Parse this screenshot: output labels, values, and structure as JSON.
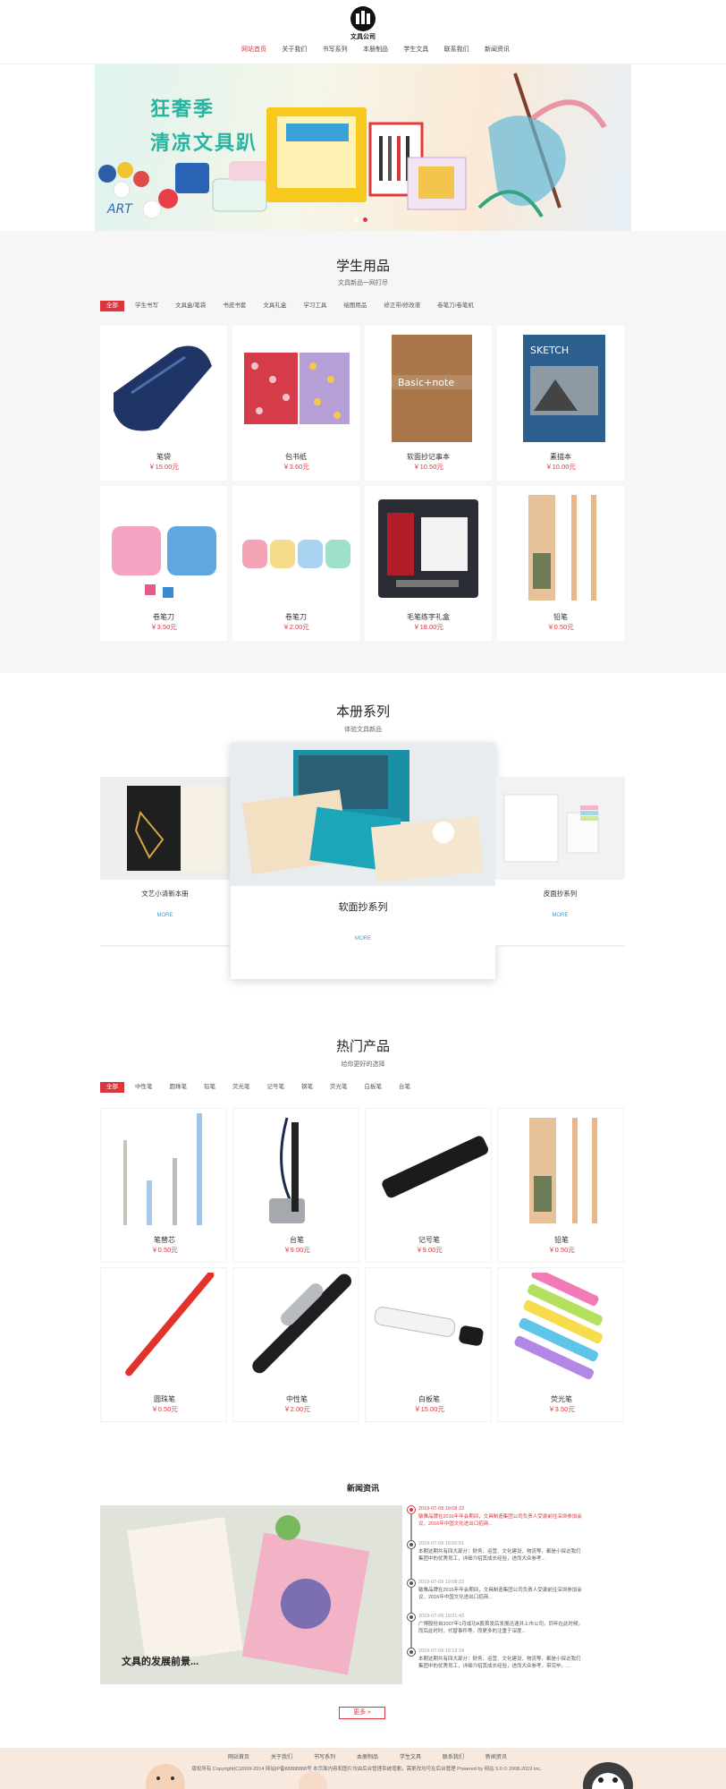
{
  "header": {
    "logo_text": "文具公司",
    "nav": [
      "网站首页",
      "关于我们",
      "书写系列",
      "本册制品",
      "学生文具",
      "联系我们",
      "新闻资讯"
    ]
  },
  "banner": {
    "line1": "狂奢季",
    "line2": "清凉文具趴",
    "art_text": "ART"
  },
  "student": {
    "title": "学生用品",
    "subtitle": "文具新品一网打尽",
    "tabs": [
      "全部",
      "学生书写",
      "文具盒/笔袋",
      "书皮书套",
      "文具礼盒",
      "学习工具",
      "绘图用品",
      "修正带/修改液",
      "卷笔刀/卷笔机"
    ],
    "items": [
      {
        "name": "笔袋",
        "price": "￥15.00元"
      },
      {
        "name": "包书纸",
        "price": "￥3.60元"
      },
      {
        "name": "软面抄记事本",
        "price": "￥10.50元"
      },
      {
        "name": "素描本",
        "price": "￥10.00元"
      },
      {
        "name": "卷笔刀",
        "price": "￥3.50元"
      },
      {
        "name": "卷笔刀",
        "price": "￥2.00元"
      },
      {
        "name": "毛笔练字礼盒",
        "price": "￥18.00元"
      },
      {
        "name": "铅笔",
        "price": "￥0.50元"
      }
    ]
  },
  "notebooks": {
    "title": "本册系列",
    "subtitle": "体验文具新品",
    "left": {
      "name": "文艺小清新本册",
      "more": "MORE"
    },
    "center": {
      "name": "软面抄系列",
      "more": "MORE"
    },
    "right": {
      "name": "皮面抄系列",
      "more": "MORE"
    }
  },
  "hot": {
    "title": "热门产品",
    "subtitle": "给你更好的选择",
    "tabs": [
      "全部",
      "中性笔",
      "圆珠笔",
      "铅笔",
      "荧光笔",
      "记号笔",
      "钢笔",
      "荧光笔",
      "白板笔",
      "台笔"
    ],
    "items": [
      {
        "name": "笔替芯",
        "price": "￥0.50元"
      },
      {
        "name": "台笔",
        "price": "￥9.00元"
      },
      {
        "name": "记号笔",
        "price": "￥9.00元"
      },
      {
        "name": "铅笔",
        "price": "￥0.50元"
      },
      {
        "name": "圆珠笔",
        "price": "￥0.50元"
      },
      {
        "name": "中性笔",
        "price": "￥2.00元"
      },
      {
        "name": "白板笔",
        "price": "￥15.00元"
      },
      {
        "name": "荧光笔",
        "price": "￥3.50元"
      }
    ]
  },
  "news": {
    "title": "新闻资讯",
    "image_caption": "文具的发展前景...",
    "items": [
      {
        "date": "2019-07-09 19:08:23",
        "text": "敏雅品牌在2016年年会期间，文具制造集团公司负责人受激前往深圳参加会议，2016年中国文化进出口招商..."
      },
      {
        "date": "2019-07-09 18:50:51",
        "text": "本期这期共有四大部分：财务、运营、文化建设、物流等，都是小探访我们集团中的优秀员工，详细介绍其成长经验，进而大众参考..."
      },
      {
        "date": "2019-07-09 19:08:23",
        "text": "敏雅品牌在2016年年会期间，文具制造集团公司负责人受激前往深圳参加会议，2016年中国文化进出口招商..."
      },
      {
        "date": "2019-07-09 19:01:43",
        "text": "广博股份自2007年1月成功A股首发后发展迅速并上市公司，同年在此时候，而后此时时，代替事件等，而更多的注重于深度..."
      },
      {
        "date": "2019-07-09 19:12:24",
        "text": "本期这期共有四大部分：财务、运营、文化建设、物流等，都是小探访我们集团中的优秀员工，详细介绍其成长经验，进而大众参考，带完毕。..."
      }
    ],
    "more": "更多 »"
  },
  "footer": {
    "nav": [
      "网站首页",
      "关于我们",
      "书写系列",
      "本册制品",
      "学生文具",
      "联系我们",
      "新闻资讯"
    ],
    "copyright": "版权所有 Copyright(C)2009-2014 网站IP备88888888号  本页面内容和图片均由后台管理系统增删，需更改均可在后台管理  Powered by 网站 5.0 © 2008-2019 Inc."
  },
  "colors": {
    "accent": "#d9363e",
    "link": "#3a9fd8",
    "banner_text": "#28b3a0"
  }
}
